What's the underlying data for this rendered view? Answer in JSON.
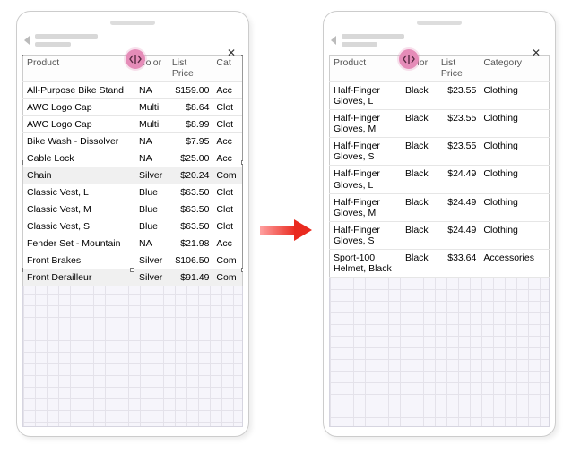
{
  "headers": {
    "product": "Product",
    "color": "Color",
    "price_l1": "List",
    "price_l2": "Price",
    "category_short": "Cat",
    "category_full": "Category"
  },
  "left_rows": [
    {
      "product": "All-Purpose Bike Stand",
      "color": "NA",
      "price": "$159.00",
      "cat": "Acc"
    },
    {
      "product": "AWC Logo Cap",
      "color": "Multi",
      "price": "$8.64",
      "cat": "Clot"
    },
    {
      "product": "AWC Logo Cap",
      "color": "Multi",
      "price": "$8.99",
      "cat": "Clot"
    },
    {
      "product": "Bike Wash - Dissolver",
      "color": "NA",
      "price": "$7.95",
      "cat": "Acc"
    },
    {
      "product": "Cable Lock",
      "color": "NA",
      "price": "$25.00",
      "cat": "Acc"
    },
    {
      "product": "Chain",
      "color": "Silver",
      "price": "$20.24",
      "cat": "Com"
    },
    {
      "product": "Classic Vest, L",
      "color": "Blue",
      "price": "$63.50",
      "cat": "Clot"
    },
    {
      "product": "Classic Vest, M",
      "color": "Blue",
      "price": "$63.50",
      "cat": "Clot"
    },
    {
      "product": "Classic Vest, S",
      "color": "Blue",
      "price": "$63.50",
      "cat": "Clot"
    },
    {
      "product": "Fender Set - Mountain",
      "color": "NA",
      "price": "$21.98",
      "cat": "Acc"
    },
    {
      "product": "Front Brakes",
      "color": "Silver",
      "price": "$106.50",
      "cat": "Com"
    },
    {
      "product": "Front Derailleur",
      "color": "Silver",
      "price": "$91.49",
      "cat": "Com"
    }
  ],
  "right_rows": [
    {
      "product": "Half-Finger Gloves, L",
      "color": "Black",
      "price": "$23.55",
      "cat": "Clothing"
    },
    {
      "product": "Half-Finger Gloves, M",
      "color": "Black",
      "price": "$23.55",
      "cat": "Clothing"
    },
    {
      "product": "Half-Finger Gloves, S",
      "color": "Black",
      "price": "$23.55",
      "cat": "Clothing"
    },
    {
      "product": "Half-Finger Gloves, L",
      "color": "Black",
      "price": "$24.49",
      "cat": "Clothing"
    },
    {
      "product": "Half-Finger Gloves, M",
      "color": "Black",
      "price": "$24.49",
      "cat": "Clothing"
    },
    {
      "product": "Half-Finger Gloves, S",
      "color": "Black",
      "price": "$24.49",
      "cat": "Clothing"
    },
    {
      "product": "Sport-100 Helmet, Black",
      "color": "Black",
      "price": "$33.64",
      "cat": "Accessories"
    }
  ],
  "icons": {
    "close": "✕"
  }
}
